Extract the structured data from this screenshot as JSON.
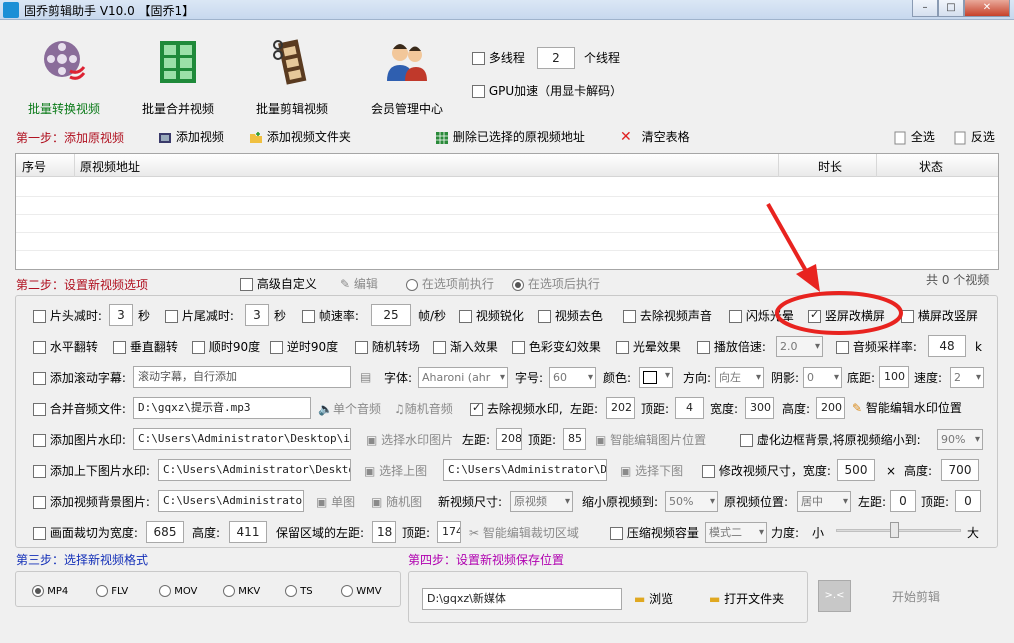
{
  "window": {
    "title": "固乔剪辑助手 V10.0 【固乔1】",
    "min": "–",
    "max": "□",
    "close": "✕"
  },
  "toolbar": {
    "batch_convert": "批量转换视频",
    "batch_merge": "批量合并视频",
    "batch_cut": "批量剪辑视频",
    "member_center": "会员管理中心",
    "multithread_label": "多线程",
    "thread_count": "2",
    "thread_unit": "个线程",
    "gpu_label": "GPU加速（用显卡解码）"
  },
  "step1": {
    "title": "第一步：添加原视频",
    "add_video": "添加视频",
    "add_folder": "添加视频文件夹",
    "delete_selected": "删除已选择的原视频地址",
    "clear_table": "清空表格",
    "select_all": "全选",
    "invert": "反选",
    "columns": [
      "序号",
      "原视频地址",
      "时长",
      "状态"
    ],
    "count": "共 0 个视频"
  },
  "step2": {
    "title": "第二步：设置新视频选项",
    "advanced": "高级自定义",
    "edit": "编辑",
    "before": "在选项前执行",
    "after": "在选项后执行",
    "row1": {
      "head_cut": "片头减时:",
      "head_val": "3",
      "sec1": "秒",
      "tail_cut": "片尾减时:",
      "tail_val": "3",
      "sec2": "秒",
      "fps": "帧速率:",
      "fps_val": "25",
      "fps_unit": "帧/秒",
      "sharpen": "视频锐化",
      "decolor": "视频去色",
      "mute": "去除视频声音",
      "flash": "闪烁光晕",
      "v2h": "竖屏改横屏",
      "h2v": "横屏改竖屏"
    },
    "row2": {
      "hflip": "水平翻转",
      "vflip": "垂直翻转",
      "cw90": "顺时90度",
      "ccw90": "逆时90度",
      "rand_trans": "随机转场",
      "fade_in": "渐入效果",
      "color_fx": "色彩变幻效果",
      "halo": "光晕效果",
      "speed": "播放倍速:",
      "speed_val": "2.0",
      "samplerate": "音频采样率:",
      "samplerate_val": "48",
      "k": "k"
    },
    "row3": {
      "scroll": "添加滚动字幕:",
      "scroll_ph": "滚动字幕，自行添加",
      "font": "字体:",
      "font_val": "Aharoni (ahr",
      "size": "字号:",
      "size_val": "60",
      "color": "颜色:",
      "dir": "方向:",
      "dir_val": "向左",
      "shadow": "阴影:",
      "shadow_val": "0",
      "bottom": "底距:",
      "bottom_val": "100",
      "speed": "速度:",
      "speed_val": "2"
    },
    "row4": {
      "merge_audio": "合并音频文件:",
      "audio_path": "D:\\gqxz\\提示音.mp3",
      "single_audio": "单个音频",
      "rand_audio": "随机音频",
      "remove_wm": "去除视频水印,",
      "left": "左距:",
      "left_val": "202",
      "top": "顶距:",
      "top_val": "4",
      "width": "宽度:",
      "width_val": "300",
      "height": "高度:",
      "height_val": "200",
      "smart_wm": "智能编辑水印位置"
    },
    "row5": {
      "img_wm": "添加图片水印:",
      "img_path": "C:\\Users\\Administrator\\Desktop\\img-q",
      "choose_wm": "选择水印图片",
      "left": "左距:",
      "left_val": "208",
      "top": "顶距:",
      "top_val": "85",
      "smart_img": "智能编辑图片位置",
      "blur_bg": "虚化边框背景,将原视频缩小到:",
      "blur_val": "90%"
    },
    "row6": {
      "tb_wm": "添加上下图片水印:",
      "top_path": "C:\\Users\\Administrator\\Desktop\\i",
      "choose_top": "选择上图",
      "bottom_path": "C:\\Users\\Administrator\\Desk",
      "choose_bottom": "选择下图",
      "resize": "修改视频尺寸，宽度:",
      "w_val": "500",
      "x": "×",
      "h_label": "高度:",
      "h_val": "700"
    },
    "row7": {
      "bg_img": "添加视频背景图片:",
      "bg_path": "C:\\Users\\Administrator\\D",
      "single": "单图",
      "random": "随机图",
      "new_size": "新视频尺寸:",
      "new_size_val": "原视频",
      "shrink": "缩小原视频到:",
      "shrink_val": "50%",
      "pos": "原视频位置:",
      "pos_val": "居中",
      "left": "左距:",
      "left_val": "0",
      "top": "顶距:",
      "top_val": "0"
    },
    "row8": {
      "crop": "画面裁切为宽度:",
      "crop_w": "685",
      "h": "高度:",
      "crop_h": "411",
      "keep_left": "保留区域的左距:",
      "keep_left_val": "18",
      "top": "顶距:",
      "top_val": "174",
      "smart_crop": "智能编辑裁切区域",
      "compress": "压缩视频容量",
      "mode_val": "模式二",
      "force": "力度:",
      "small": "小",
      "big": "大"
    }
  },
  "step3": {
    "title": "第三步：选择新视频格式",
    "formats": [
      "MP4",
      "FLV",
      "MOV",
      "MKV",
      "TS",
      "WMV"
    ]
  },
  "step4": {
    "title": "第四步：设置新视频保存位置",
    "path": "D:\\gqxz\\新媒体",
    "browse": "浏览",
    "open_folder": "打开文件夹",
    "start": "开始剪辑"
  },
  "colors": {
    "step_title_red": "#b0101f",
    "step_title_purple": "#b000b0",
    "step_title_blue": "#1430b8",
    "annotation_red": "#e8231f"
  }
}
